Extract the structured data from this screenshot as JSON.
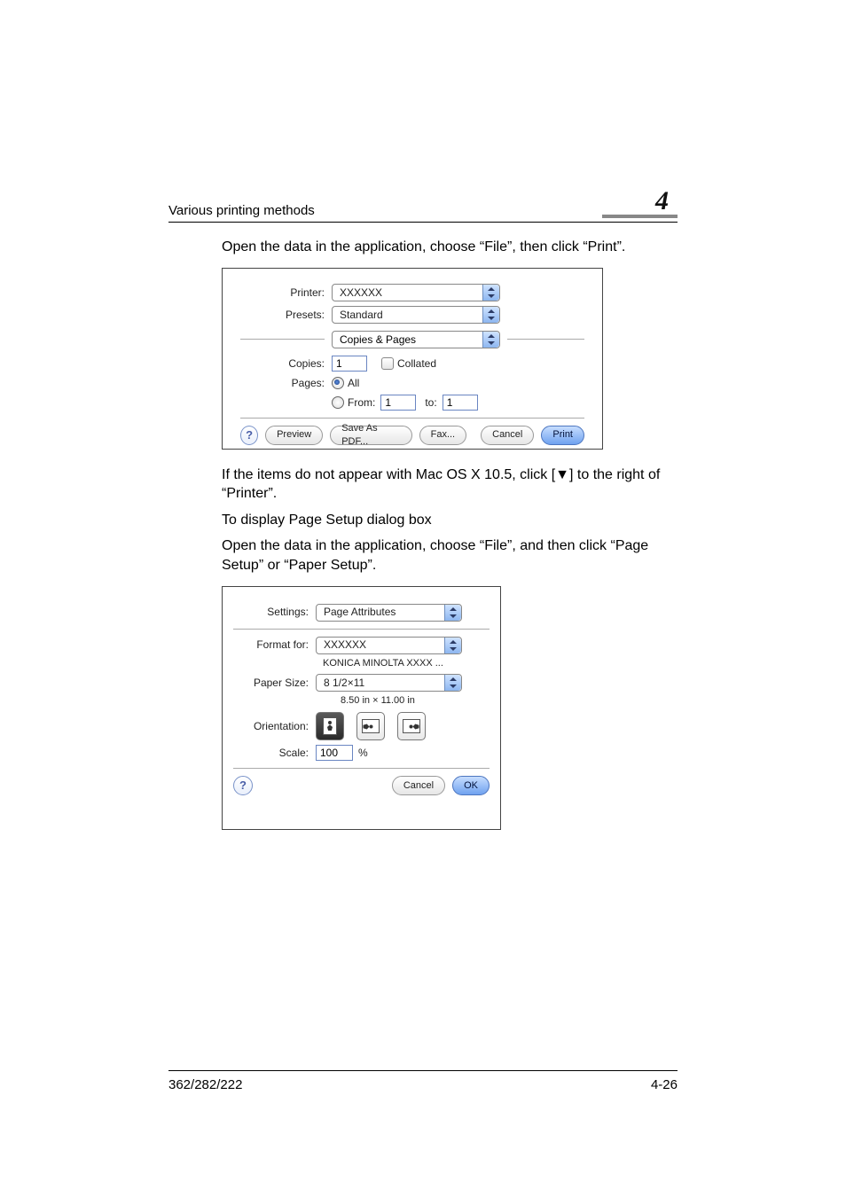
{
  "header": {
    "running_title": "Various printing methods",
    "chapter_number": "4"
  },
  "paragraphs": {
    "p1": "Open the data in the application, choose “File”, then click “Print”.",
    "p2": "If the items do not appear with Mac OS X 10.5, click [▼] to the right of “Printer”.",
    "p3": "To display Page Setup dialog box",
    "p4": "Open the data in the application, choose “File”, and then click “Page Setup” or “Paper Setup”."
  },
  "print_dialog": {
    "labels": {
      "printer": "Printer:",
      "presets": "Presets:",
      "copies": "Copies:",
      "pages": "Pages:",
      "from": "From:",
      "to": "to:",
      "collated": "Collated",
      "all": "All"
    },
    "values": {
      "printer": "XXXXXX",
      "presets": "Standard",
      "pane": "Copies & Pages",
      "copies": "1",
      "from": "1",
      "to": "1"
    },
    "buttons": {
      "help": "?",
      "preview": "Preview",
      "save_pdf": "Save As PDF...",
      "fax": "Fax...",
      "cancel": "Cancel",
      "print": "Print"
    }
  },
  "page_setup_dialog": {
    "labels": {
      "settings": "Settings:",
      "format_for": "Format for:",
      "paper_size": "Paper Size:",
      "orientation": "Orientation:",
      "scale": "Scale:",
      "percent": "%"
    },
    "values": {
      "settings": "Page Attributes",
      "format_for": "XXXXXX",
      "format_for_sub": "KONICA MINOLTA  XXXX ...",
      "paper_size": "8 1/2×11",
      "paper_size_sub": "8.50 in × 11.00 in",
      "scale": "100"
    },
    "buttons": {
      "help": "?",
      "cancel": "Cancel",
      "ok": "OK"
    }
  },
  "footer": {
    "model": "362/282/222",
    "page": "4-26"
  }
}
